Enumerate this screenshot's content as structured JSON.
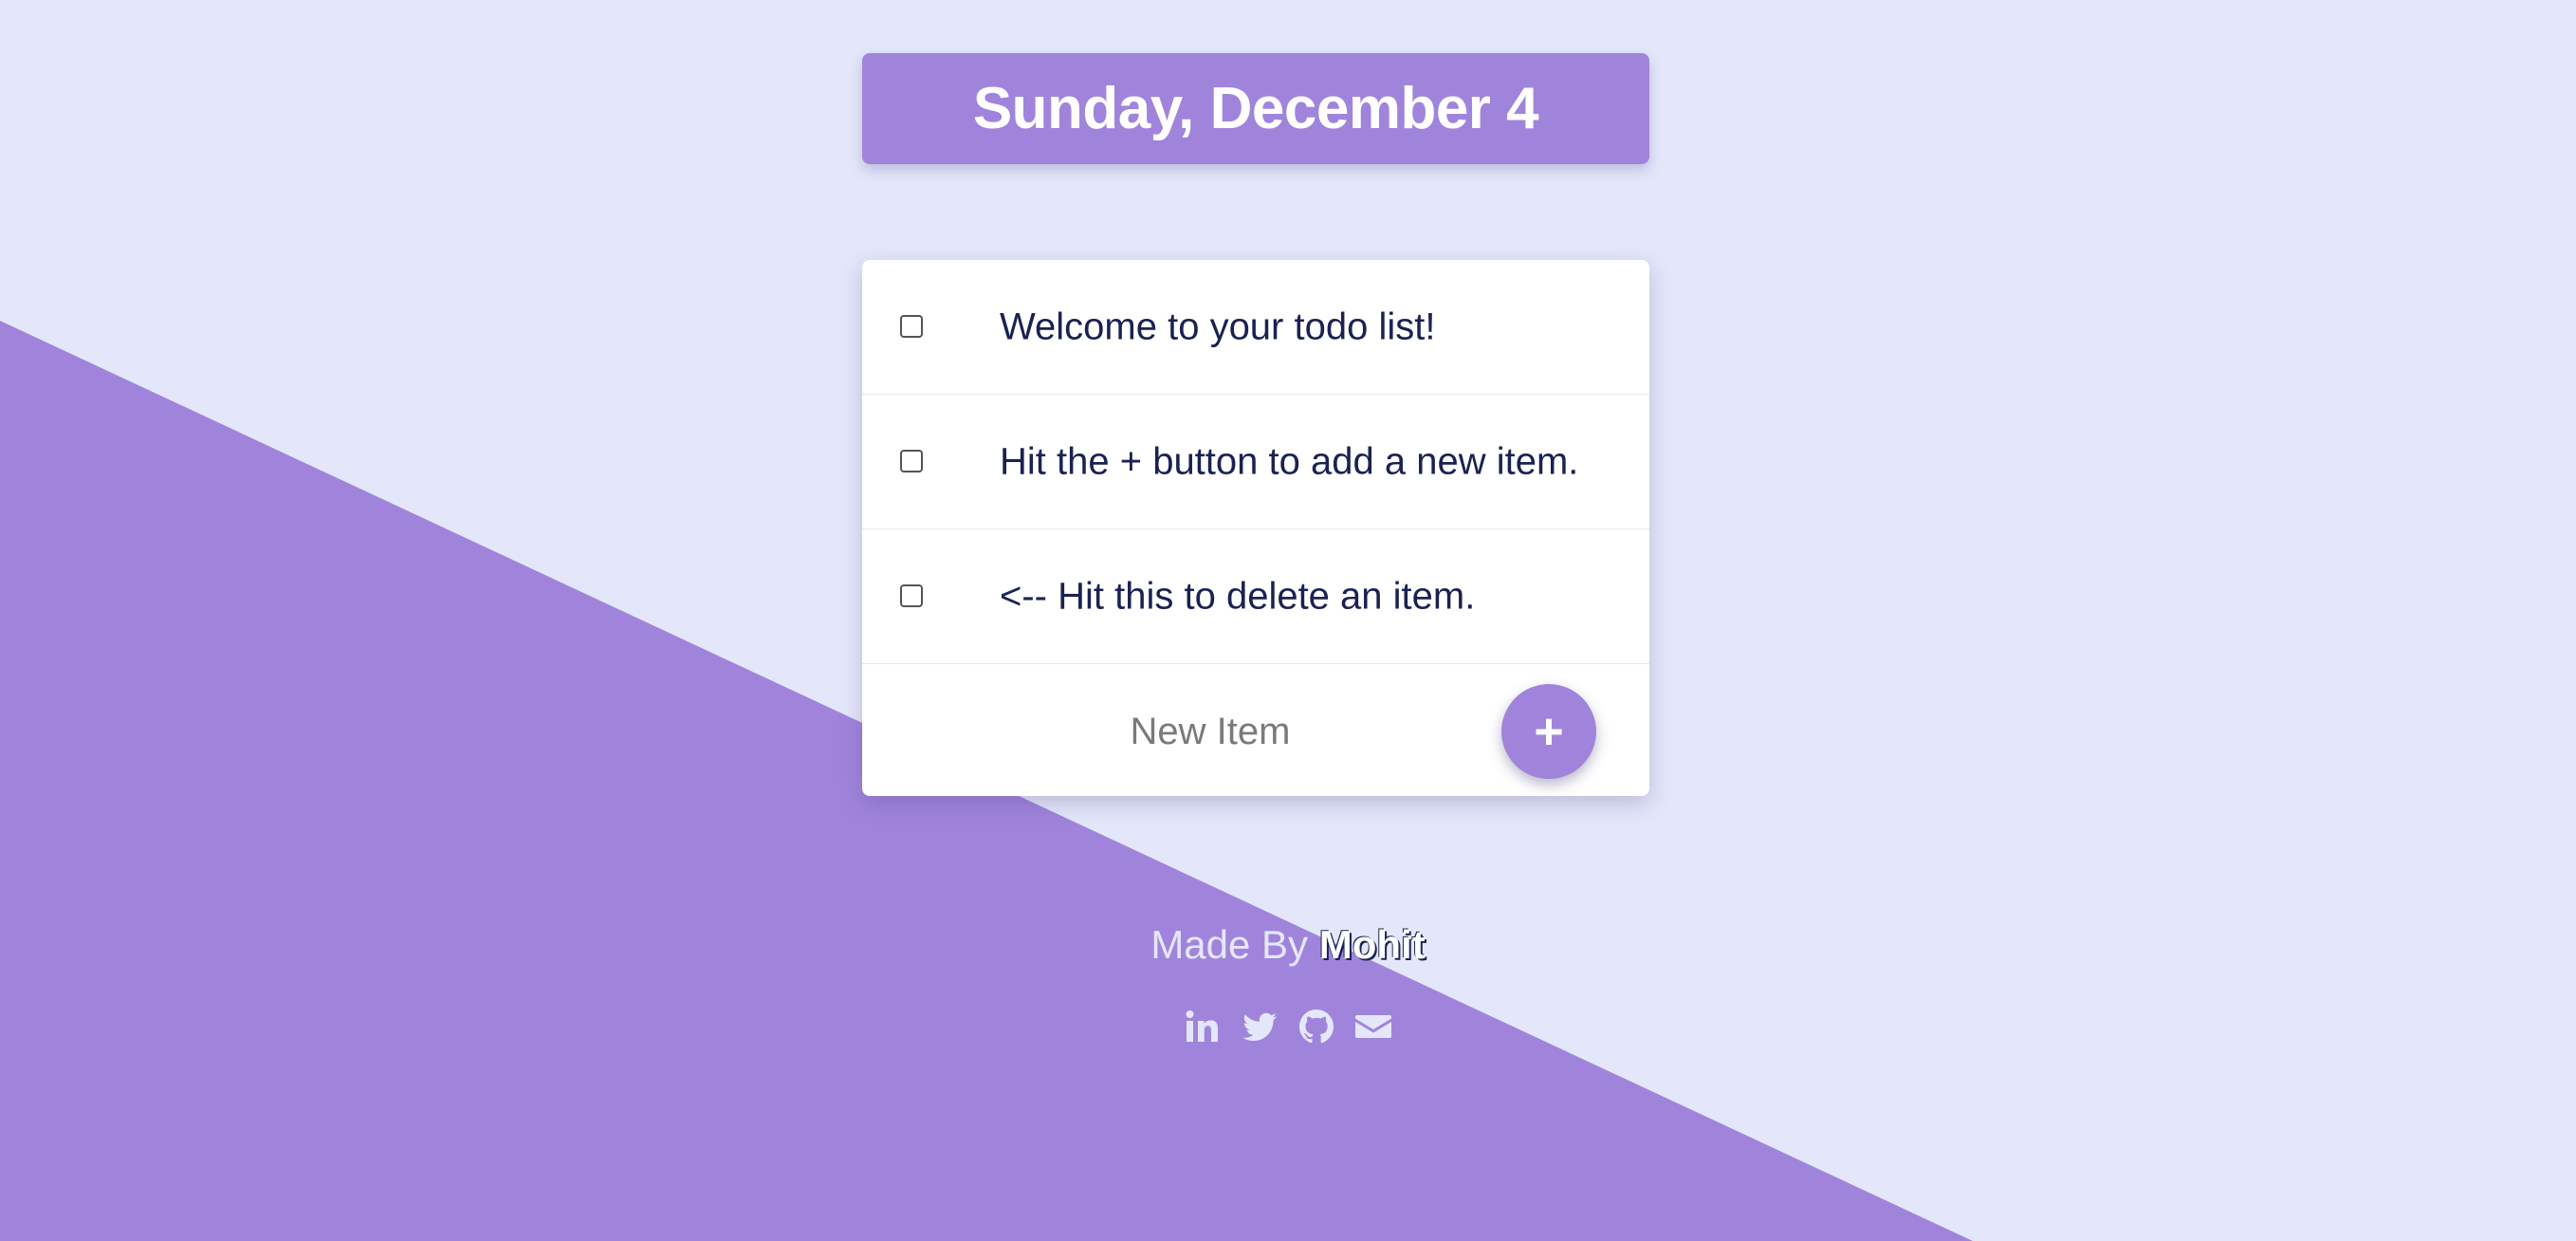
{
  "heading": {
    "date": "Sunday, December 4"
  },
  "todo": {
    "items": [
      {
        "text": "Welcome to your todo list!",
        "checked": false
      },
      {
        "text": "Hit the + button to add a new item.",
        "checked": false
      },
      {
        "text": "<-- Hit this to delete an item.",
        "checked": false
      }
    ],
    "new_item_placeholder": "New Item",
    "add_button_label": "+"
  },
  "footer": {
    "made_by_label": "Made By",
    "author_name": "Mohit",
    "social_icons": [
      "linkedin-icon",
      "twitter-icon",
      "github-icon",
      "email-icon"
    ]
  },
  "colors": {
    "background": "#E4E7FA",
    "accent": "#A084DC",
    "text_dark": "#1A2253"
  }
}
